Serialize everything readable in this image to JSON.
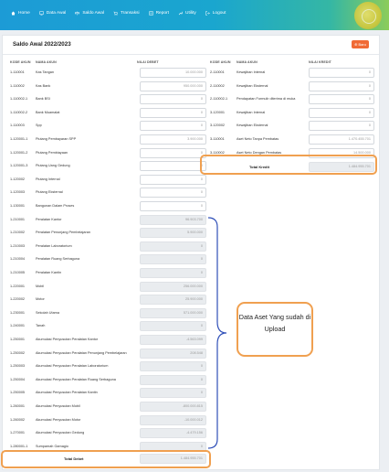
{
  "nav": [
    {
      "label": "Home",
      "icon": "home-icon"
    },
    {
      "label": "Data Awal",
      "icon": "monitor-icon"
    },
    {
      "label": "Saldo Awal",
      "icon": "scale-icon"
    },
    {
      "label": "Transaksi",
      "icon": "cart-icon"
    },
    {
      "label": "Report",
      "icon": "report-icon"
    },
    {
      "label": "Utility",
      "icon": "wrench-icon"
    },
    {
      "label": "Logout",
      "icon": "logout-icon"
    }
  ],
  "page": {
    "title": "Saldo Awal 2022/2023",
    "new_button": "Baru"
  },
  "left": {
    "headers": {
      "code": "KODE AKUN",
      "name": "NAMA AKUN",
      "value": "NILAI DEBET"
    },
    "rows": [
      {
        "code": "1-110001",
        "name": "Kas Tangan",
        "value": "10.000.000",
        "readonly": false
      },
      {
        "code": "1-110002",
        "name": "Kas Bank",
        "value": "950.000.000",
        "readonly": false
      },
      {
        "code": "1-110002-1",
        "name": "Bank BSI",
        "value": "0",
        "readonly": false
      },
      {
        "code": "1-110002-2",
        "name": "Bank Muamalat",
        "value": "0",
        "readonly": false
      },
      {
        "code": "1-110003",
        "name": "Spp",
        "value": "0",
        "readonly": false
      },
      {
        "code": "1-120001-1",
        "name": "Piutang Pembayaran SPP",
        "value": "3.900.000",
        "readonly": false
      },
      {
        "code": "1-120001-2",
        "name": "Piutang Pembiayaan",
        "value": "0",
        "readonly": false
      },
      {
        "code": "1-120001-3",
        "name": "Piutang Uang Gedung",
        "value": "0",
        "readonly": false
      },
      {
        "code": "1-120002",
        "name": "Piutang Internal",
        "value": "0",
        "readonly": false
      },
      {
        "code": "1-120003",
        "name": "Piutang Eksternal",
        "value": "0",
        "readonly": false
      },
      {
        "code": "1-130001",
        "name": "Bangunan Dalam Proses",
        "value": "0",
        "readonly": false
      },
      {
        "code": "1-210001",
        "name": "Peralatan Kantor",
        "value": "96.903.700",
        "readonly": true
      },
      {
        "code": "1-210002",
        "name": "Peralatan Penunjang Pembelajaran",
        "value": "5.900.000",
        "readonly": true
      },
      {
        "code": "1-210003",
        "name": "Peralatan Laboratorium",
        "value": "0",
        "readonly": true
      },
      {
        "code": "1-210004",
        "name": "Peralatan Ruang Serbaguna",
        "value": "0",
        "readonly": true
      },
      {
        "code": "1-210005",
        "name": "Peralatan Kantin",
        "value": "0",
        "readonly": true
      },
      {
        "code": "1-220001",
        "name": "Mobil",
        "value": "256.000.000",
        "readonly": true
      },
      {
        "code": "1-220002",
        "name": "Motor",
        "value": "25.900.000",
        "readonly": true
      },
      {
        "code": "1-230001",
        "name": "Sekolah Utama",
        "value": "571.000.000",
        "readonly": true
      },
      {
        "code": "1-240001",
        "name": "Tanah",
        "value": "0",
        "readonly": true
      },
      {
        "code": "1-250001",
        "name": "Akumulasi Penyusutan Peralatan Kantor",
        "value": "-4.563.099",
        "readonly": true
      },
      {
        "code": "1-250002",
        "name": "Akumulasi Penyusutan Peralatan Penunjang Pembelajaran",
        "value": "208.548",
        "readonly": true
      },
      {
        "code": "1-250003",
        "name": "Akumulasi Penyusutan Peralatan Laboratorium",
        "value": "0",
        "readonly": true
      },
      {
        "code": "1-250004",
        "name": "Akumulasi Penyusutan Peralatan Ruang Serbaguna",
        "value": "0",
        "readonly": true
      },
      {
        "code": "1-250005",
        "name": "Akumulasi Penyusutan Peralatan Kantin",
        "value": "0",
        "readonly": true
      },
      {
        "code": "1-260001",
        "name": "Akumulasi Penyusutan Mobil",
        "value": "-800.000.815",
        "readonly": true
      },
      {
        "code": "1-260002",
        "name": "Akumulasi Penyusutan Motor",
        "value": "-10.000.012",
        "readonly": true
      },
      {
        "code": "1-270001",
        "name": "Akumulasi Penyusutan Gedung",
        "value": "-4.479.156",
        "readonly": true
      },
      {
        "code": "1-280001-1",
        "name": "Sumpamah Gamagio",
        "value": "0",
        "readonly": true
      }
    ],
    "total_label": "Total Debet",
    "total_value": "1.484.955.701"
  },
  "right": {
    "headers": {
      "code": "KODE AKUN",
      "name": "NAMA AKUN",
      "value": "NILAI KREDIT"
    },
    "rows": [
      {
        "code": "2-110001",
        "name": "Kewajiban Internal",
        "value": "0",
        "readonly": false
      },
      {
        "code": "2-110002",
        "name": "Kewajiban Eksternal",
        "value": "0",
        "readonly": false
      },
      {
        "code": "2-110002-1",
        "name": "Pendapatan Formulir diterima di muka",
        "value": "0",
        "readonly": false
      },
      {
        "code": "3-120001",
        "name": "Kewajiban Internal",
        "value": "0",
        "readonly": false
      },
      {
        "code": "3-120002",
        "name": "Kewajiban Eksternal",
        "value": "0",
        "readonly": false
      },
      {
        "code": "3-110001",
        "name": "Aset Neto Tanpa Pembatas",
        "value": "1.470.455.701",
        "readonly": false
      },
      {
        "code": "3-110002",
        "name": "Aset Neto Dengan Pembatas",
        "value": "14.500.000",
        "readonly": false
      }
    ],
    "total_label": "Total Kredit",
    "total_value": "1.484.955.701"
  },
  "annotation": {
    "text": "Data Aset Yang sudah di Upload"
  },
  "colors": {
    "accent": "#f06a35",
    "highlight": "#f0a050",
    "brace": "#2f4fb8"
  }
}
